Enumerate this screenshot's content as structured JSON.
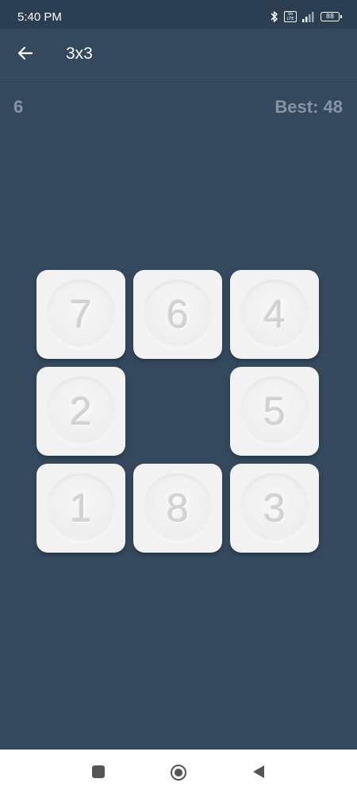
{
  "status_bar": {
    "time": "5:40 PM",
    "volte_label": "Vo\nLTE",
    "battery_level": "88"
  },
  "app_bar": {
    "title": "3x3"
  },
  "scores": {
    "moves": "6",
    "best": "Best: 48"
  },
  "board": {
    "size": 3,
    "tiles": [
      {
        "number": "7",
        "row": 0,
        "col": 0
      },
      {
        "number": "6",
        "row": 0,
        "col": 1
      },
      {
        "number": "4",
        "row": 0,
        "col": 2
      },
      {
        "number": "2",
        "row": 1,
        "col": 0
      },
      {
        "number": "5",
        "row": 1,
        "col": 2
      },
      {
        "number": "1",
        "row": 2,
        "col": 0
      },
      {
        "number": "8",
        "row": 2,
        "col": 1
      },
      {
        "number": "3",
        "row": 2,
        "col": 2
      }
    ],
    "empty_cell": {
      "row": 1,
      "col": 1
    }
  },
  "colors": {
    "background": "#34495e",
    "status_bar": "#2c3e52",
    "tile": "#f2f2f2",
    "tile_number": "#d2d2d2",
    "score_text": "#8694a3"
  },
  "icons": {
    "back": "arrow-left-icon",
    "bluetooth": "bluetooth-icon",
    "signal": "signal-icon",
    "battery": "battery-icon",
    "nav_recent": "square-icon",
    "nav_home": "circle-icon",
    "nav_back": "triangle-icon"
  }
}
